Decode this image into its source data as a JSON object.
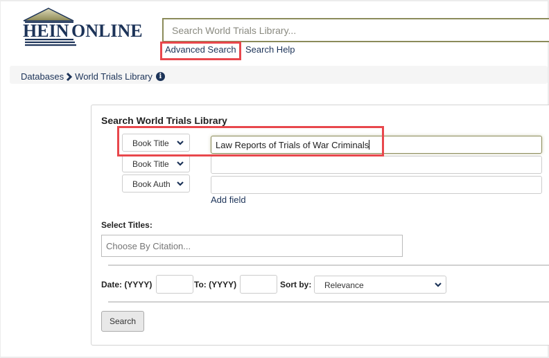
{
  "brand": {
    "logo_text": "HeinOnline",
    "logo_hein": "HEIN",
    "logo_online": "ONLINE"
  },
  "header": {
    "search_placeholder": "Search World Trials Library...",
    "search_value": "",
    "advanced_search_label": "Advanced Search",
    "search_help_label": "Search Help"
  },
  "breadcrumb": {
    "items": [
      "Databases",
      "World Trials Library"
    ],
    "separator_icon": "chevron-right-icon",
    "info_icon": "info-circle-icon"
  },
  "panel": {
    "title": "Search World Trials Library",
    "fields": [
      {
        "field_type": "Book Title",
        "value": "Law Reports of Trials of War Criminals",
        "focused": true
      },
      {
        "field_type": "Book Title",
        "value": "",
        "focused": false
      },
      {
        "field_type": "Book Auth",
        "value": "",
        "focused": false
      }
    ],
    "add_field_label": "Add field",
    "select_titles_label": "Select Titles:",
    "citation_placeholder": "Choose By Citation...",
    "date_from_label": "Date: (YYYY)",
    "date_from_value": "",
    "date_to_label": "To: (YYYY)",
    "date_to_value": "",
    "sort_by_label": "Sort by:",
    "sort_by_value": "Relevance",
    "search_button_label": "Search"
  },
  "colors": {
    "brand_navy": "#1c3358",
    "brand_olive": "#8b8b5a",
    "highlight_red": "#e8474c"
  }
}
